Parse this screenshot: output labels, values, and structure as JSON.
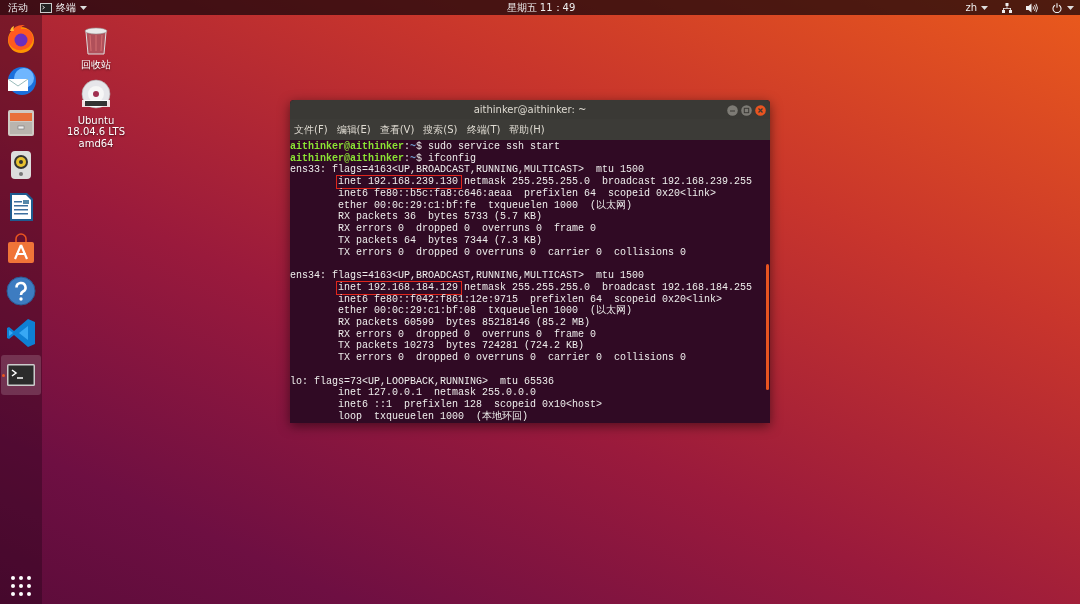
{
  "top_bar": {
    "activities": "活动",
    "app_menu": {
      "label": "终端"
    },
    "clock": "星期五 11：49",
    "input_method": "zh"
  },
  "dock": {
    "items": [
      {
        "kind": "browser",
        "running": false
      },
      {
        "kind": "mail",
        "running": false
      },
      {
        "kind": "files",
        "running": false
      },
      {
        "kind": "music",
        "running": false
      },
      {
        "kind": "writer",
        "running": false
      },
      {
        "kind": "store",
        "running": false
      },
      {
        "kind": "help",
        "running": false
      },
      {
        "kind": "editor",
        "running": false
      },
      {
        "kind": "terminal",
        "running": true
      }
    ]
  },
  "desktop_icons": [
    {
      "kind": "trash",
      "label_lines": [
        "回收站"
      ]
    },
    {
      "kind": "disc",
      "label_lines": [
        "Ubuntu",
        "18.04.6 LTS",
        "amd64"
      ]
    }
  ],
  "terminal_window": {
    "title": "aithinker@aithinker: ~",
    "menu": [
      "文件(F)",
      "编辑(E)",
      "查看(V)",
      "搜索(S)",
      "终端(T)",
      "帮助(H)"
    ],
    "lines": [
      {
        "kind": "prompt",
        "user": "aithinker@aithinker",
        "separator": ":",
        "path": "~",
        "command": "$ sudo service ssh start"
      },
      {
        "kind": "prompt",
        "user": "aithinker@aithinker",
        "separator": ":",
        "path": "~",
        "command": "$ ifconfig"
      },
      {
        "kind": "header",
        "text": "ens33: flags=4163<UP,BROADCAST,RUNNING,MULTICAST>  mtu 1500"
      },
      {
        "kind": "boxed",
        "boxed": "inet 192.168.239.130",
        "text": "netmask 255.255.255.0  broadcast 192.168.239.255"
      },
      {
        "kind": "detail",
        "text": "inet6 fe80::b5c:fa8:c646:aeaa  prefixlen 64  scopeid 0x20<link>"
      },
      {
        "kind": "detail",
        "text": "ether 00:0c:29:c1:bf:fe  txqueuelen 1000  (以太网)"
      },
      {
        "kind": "detail",
        "text": "RX packets 36  bytes 5733 (5.7 KB)"
      },
      {
        "kind": "detail",
        "text": "RX errors 0  dropped 0  overruns 0  frame 0"
      },
      {
        "kind": "detail",
        "text": "TX packets 64  bytes 7344 (7.3 KB)"
      },
      {
        "kind": "detail",
        "text": "TX errors 0  dropped 0 overruns 0  carrier 0  collisions 0"
      },
      {
        "kind": "blank"
      },
      {
        "kind": "header",
        "text": "ens34: flags=4163<UP,BROADCAST,RUNNING,MULTICAST>  mtu 1500"
      },
      {
        "kind": "boxed",
        "boxed": "inet 192.168.184.129",
        "text": "netmask 255.255.255.0  broadcast 192.168.184.255"
      },
      {
        "kind": "detail",
        "text": "inet6 fe80::f042:f861:12e:9715  prefixlen 64  scopeid 0x20<link>"
      },
      {
        "kind": "detail",
        "text": "ether 00:0c:29:c1:bf:08  txqueuelen 1000  (以太网)"
      },
      {
        "kind": "detail",
        "text": "RX packets 60599  bytes 85218146 (85.2 MB)"
      },
      {
        "kind": "detail",
        "text": "RX errors 0  dropped 0  overruns 0  frame 0"
      },
      {
        "kind": "detail",
        "text": "TX packets 10273  bytes 724281 (724.2 KB)"
      },
      {
        "kind": "detail",
        "text": "TX errors 0  dropped 0 overruns 0  carrier 0  collisions 0"
      },
      {
        "kind": "blank"
      },
      {
        "kind": "header",
        "text": "lo: flags=73<UP,LOOPBACK,RUNNING>  mtu 65536"
      },
      {
        "kind": "detail",
        "text": "inet 127.0.0.1  netmask 255.0.0.0"
      },
      {
        "kind": "detail",
        "text": "inet6 ::1  prefixlen 128  scopeid 0x10<host>"
      },
      {
        "kind": "detail",
        "text": "loop  txqueuelen 1000  (本地环回)"
      }
    ]
  }
}
